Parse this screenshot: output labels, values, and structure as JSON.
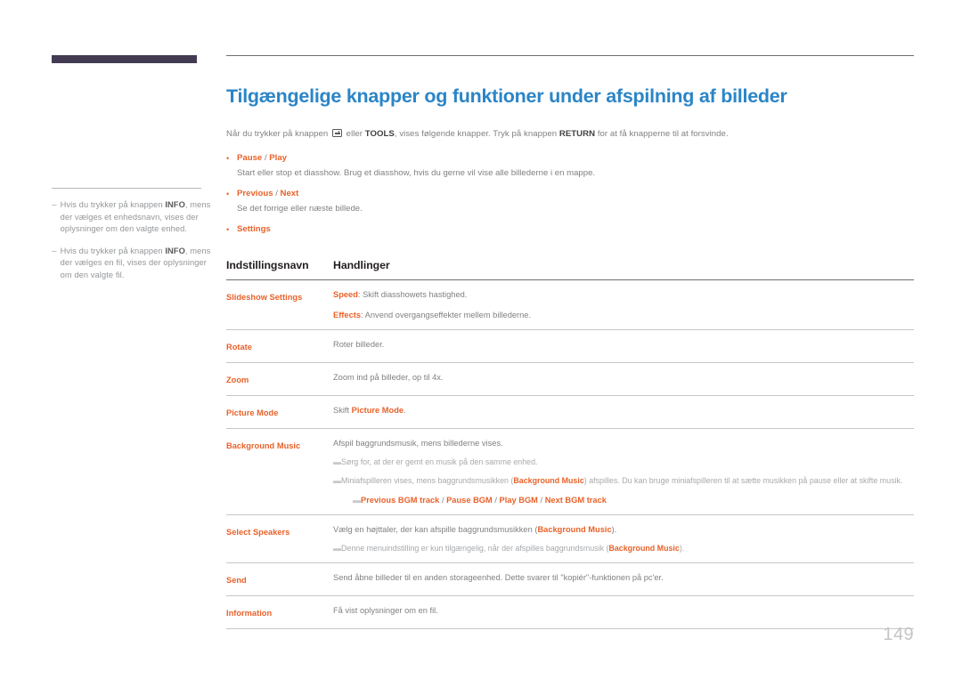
{
  "sidebar": {
    "notes": [
      {
        "dash": "–",
        "parts": [
          {
            "t": "Hvis du trykker på knappen ",
            "b": false
          },
          {
            "t": "INFO",
            "b": true
          },
          {
            "t": ", mens der vælges et enhedsnavn, vises der oplysninger om den valgte enhed.",
            "b": false
          }
        ]
      },
      {
        "dash": "–",
        "parts": [
          {
            "t": "Hvis du trykker på knappen ",
            "b": false
          },
          {
            "t": "INFO",
            "b": true
          },
          {
            "t": ", mens der vælges en fil, vises der oplysninger om den valgte fil.",
            "b": false
          }
        ]
      }
    ]
  },
  "main": {
    "title": "Tilgængelige knapper og funktioner under afspilning af billeder",
    "intro": {
      "before_icon": "Når du trykker på knappen ",
      "icon": "enter-key-icon",
      "after_icon": " eller ",
      "bold1": "TOOLS",
      "middle": ", vises følgende knapper. Tryk på knappen ",
      "bold2": "RETURN",
      "tail": " for at få knapperne til at forsvinde."
    },
    "bullets": [
      {
        "dot": "•",
        "title_a": "Pause",
        "sep": " / ",
        "title_b": "Play",
        "desc": "Start eller stop et diasshow. Brug et diasshow, hvis du gerne vil vise alle billederne i en mappe."
      },
      {
        "dot": "•",
        "title_a": "Previous",
        "sep": " / ",
        "title_b": "Next",
        "desc": "Se det forrige eller næste billede."
      },
      {
        "dot": "•",
        "title_a": "Settings",
        "sep": "",
        "title_b": "",
        "desc": ""
      }
    ],
    "table": {
      "headers": [
        "Indstillingsnavn",
        "Handlinger"
      ],
      "rows": [
        {
          "name": "Slideshow Settings",
          "lines": [
            {
              "bold_lead": "Speed",
              "text": ": Skift diasshowets hastighed."
            },
            {
              "bold_lead": "Effects",
              "text": ": Anvend overgangseffekter mellem billederne."
            }
          ],
          "notes": []
        },
        {
          "name": "Rotate",
          "lines": [
            {
              "bold_lead": "",
              "text": "Roter billeder."
            }
          ],
          "notes": []
        },
        {
          "name": "Zoom",
          "lines": [
            {
              "bold_lead": "",
              "text": "Zoom ind på billeder, op til 4x."
            }
          ],
          "notes": []
        },
        {
          "name": "Picture Mode",
          "lines": [
            {
              "bold_lead": "",
              "text": "Skift ",
              "bold_tail": "Picture Mode",
              "tail": "."
            }
          ],
          "notes": []
        },
        {
          "name": "Background Music",
          "lines": [
            {
              "bold_lead": "",
              "text": "Afspil baggrundsmusik, mens billederne vises."
            }
          ],
          "notes": [
            {
              "dash": "▬",
              "indent": false,
              "parts": [
                {
                  "t": "Sørg for, at der er gemt en musik på den samme enhed.",
                  "b": false
                }
              ]
            },
            {
              "dash": "▬",
              "indent": false,
              "parts": [
                {
                  "t": "Miniafspilleren vises, mens baggrundsmusikken (",
                  "b": false
                },
                {
                  "t": "Background Music",
                  "b": true
                },
                {
                  "t": ") afspilles. Du kan bruge miniafspilleren til at sætte musikken på pause eller at skifte musik.",
                  "b": false
                }
              ]
            },
            {
              "dash": "▬",
              "indent": true,
              "parts": [
                {
                  "t": "Previous BGM track",
                  "b": true
                },
                {
                  "t": " / ",
                  "b": false
                },
                {
                  "t": "Pause BGM",
                  "b": true
                },
                {
                  "t": " / ",
                  "b": false
                },
                {
                  "t": "Play BGM",
                  "b": true
                },
                {
                  "t": " / ",
                  "b": false
                },
                {
                  "t": "Next BGM track",
                  "b": true
                }
              ]
            }
          ]
        },
        {
          "name": "Select Speakers",
          "lines": [
            {
              "bold_lead": "",
              "text": "Vælg en højttaler, der kan afspille baggrundsmusikken (",
              "bold_tail": "Background Music",
              "tail": ")."
            }
          ],
          "notes": [
            {
              "dash": "▬",
              "indent": false,
              "parts": [
                {
                  "t": "Denne menuindstilling er kun tilgængelig, når der afspilles baggrundsmusik (",
                  "b": false
                },
                {
                  "t": "Background Music",
                  "b": true
                },
                {
                  "t": ").",
                  "b": false
                }
              ]
            }
          ]
        },
        {
          "name": "Send",
          "lines": [
            {
              "bold_lead": "",
              "text": "Send åbne billeder til en anden storageenhed. Dette svarer til \"kopiér\"-funktionen på pc'er."
            }
          ],
          "notes": []
        },
        {
          "name": "Information",
          "lines": [
            {
              "bold_lead": "",
              "text": "Få vist oplysninger om en fil."
            }
          ],
          "notes": []
        }
      ]
    }
  },
  "footer": {
    "page_number": "149"
  },
  "colors": {
    "heading_blue": "#2b85c6",
    "accent_orange": "#e8622a",
    "body_gray": "#808184",
    "bar_purple": "#433b52",
    "page_number_gray": "#c3c4c6"
  }
}
